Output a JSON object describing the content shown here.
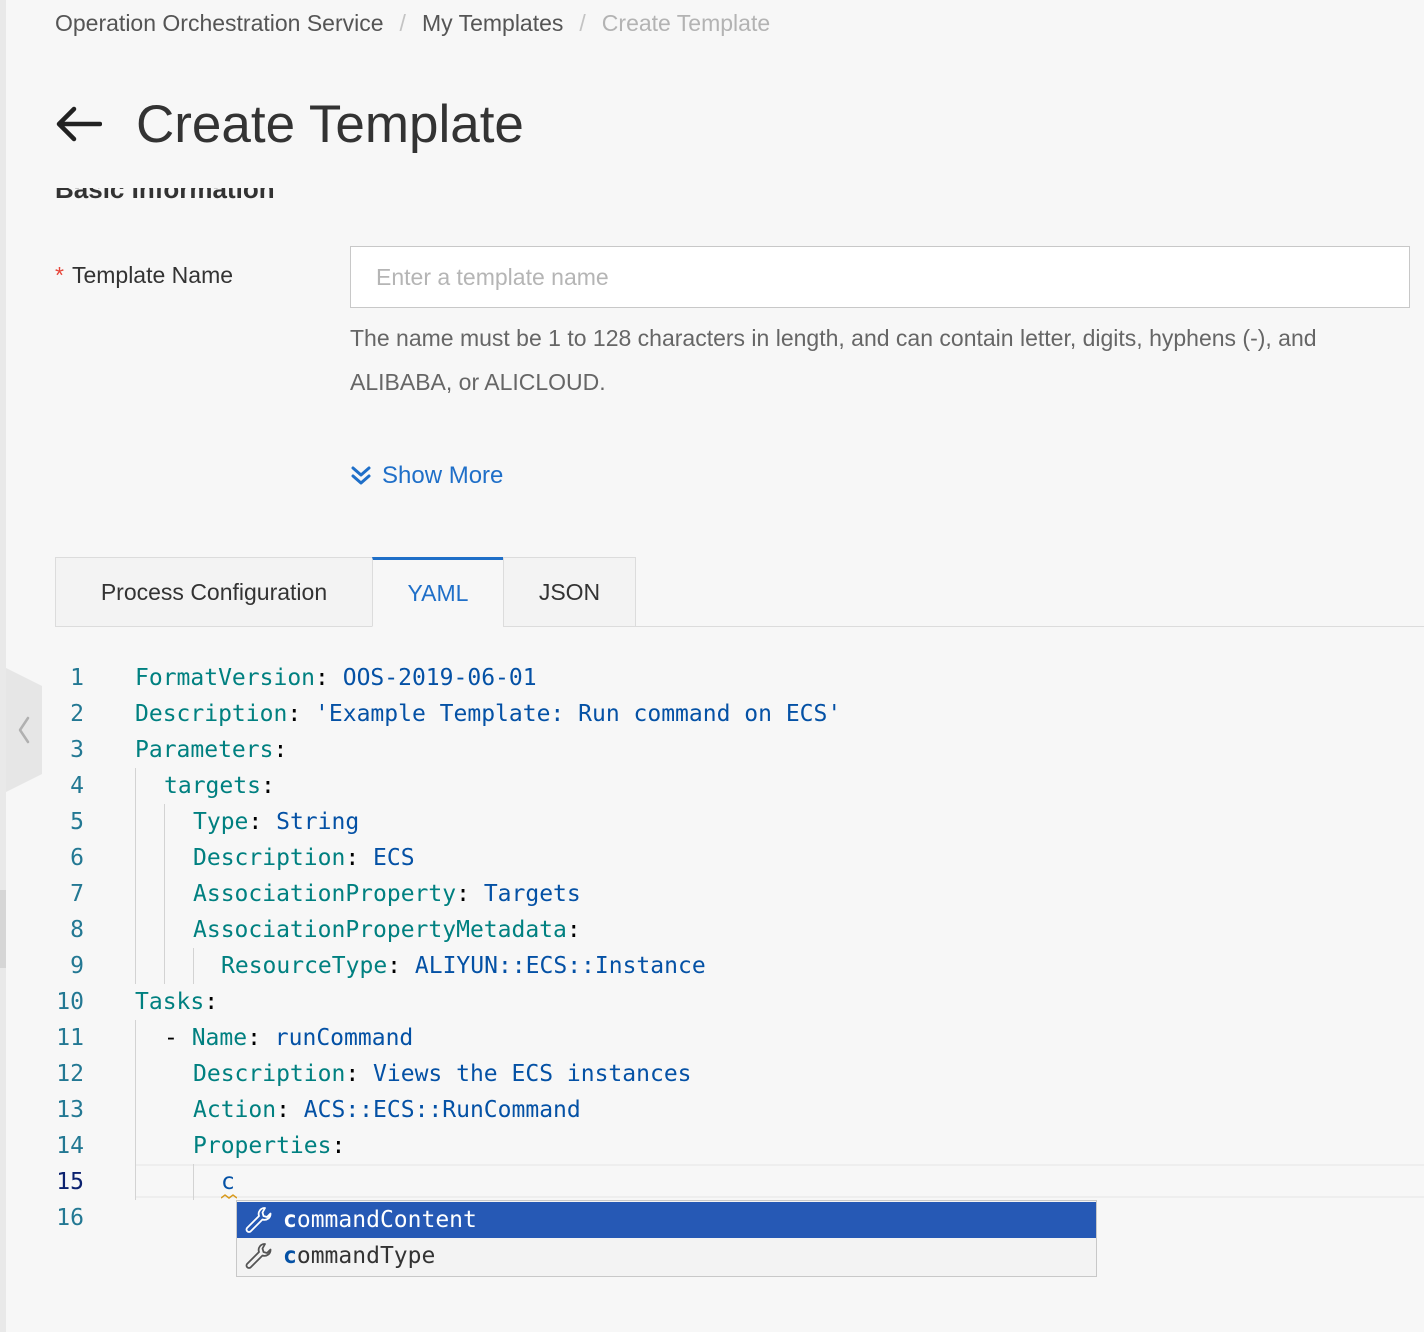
{
  "breadcrumb": {
    "items": [
      "Operation Orchestration Service",
      "My Templates"
    ],
    "current": "Create Template",
    "separator": "/"
  },
  "header": {
    "title": "Create Template",
    "back_icon": "arrow-left-icon"
  },
  "section": {
    "title": "Basic Information"
  },
  "form": {
    "template_name": {
      "required_mark": "*",
      "label": "Template Name",
      "value": "",
      "placeholder": "Enter a template name",
      "hint_line1": "The name must be 1 to 128 characters in length, and can contain letter, digits, hyphens (-), and",
      "hint_line2": "ALIBABA, or ALICLOUD."
    },
    "show_more": {
      "label": "Show More",
      "icon": "double-chevron-down-icon"
    }
  },
  "tabs": [
    {
      "label": "Process Configuration",
      "active": false
    },
    {
      "label": "YAML",
      "active": true
    },
    {
      "label": "JSON",
      "active": false
    }
  ],
  "editor": {
    "lines": [
      {
        "num": "1",
        "key": "FormatVersion",
        "value": "OOS-2019-06-01"
      },
      {
        "num": "2",
        "key": "Description",
        "value": "'Example Template: Run command on ECS'"
      },
      {
        "num": "3",
        "key": "Parameters",
        "value": ""
      },
      {
        "num": "4",
        "key": "targets",
        "value": ""
      },
      {
        "num": "5",
        "key": "Type",
        "value": "String"
      },
      {
        "num": "6",
        "key": "Description",
        "value": "ECS"
      },
      {
        "num": "7",
        "key": "AssociationProperty",
        "value": "Targets"
      },
      {
        "num": "8",
        "key": "AssociationPropertyMetadata",
        "value": ""
      },
      {
        "num": "9",
        "key": "ResourceType",
        "value": "ALIYUN::ECS::Instance"
      },
      {
        "num": "10",
        "key": "Tasks",
        "value": ""
      },
      {
        "num": "11",
        "key": "Name",
        "value": "runCommand"
      },
      {
        "num": "12",
        "key": "Description",
        "value": "Views the ECS instances"
      },
      {
        "num": "13",
        "key": "Action",
        "value": "ACS::ECS::RunCommand"
      },
      {
        "num": "14",
        "key": "Properties",
        "value": ""
      },
      {
        "num": "15",
        "key": "",
        "value": "c"
      },
      {
        "num": "16",
        "key": "",
        "value": ""
      }
    ],
    "current_line": 15,
    "suggestions": [
      {
        "match": "c",
        "rest": "ommandContent",
        "selected": true,
        "icon": "wrench-icon"
      },
      {
        "match": "c",
        "rest": "ommandType",
        "selected": false,
        "icon": "wrench-icon"
      }
    ]
  },
  "colors": {
    "accent": "#1f6fc8",
    "required": "#e6463a",
    "yaml_key": "#008080",
    "yaml_value": "#0451a5",
    "line_number": "#237893",
    "suggest_selected": "#2659b5"
  }
}
